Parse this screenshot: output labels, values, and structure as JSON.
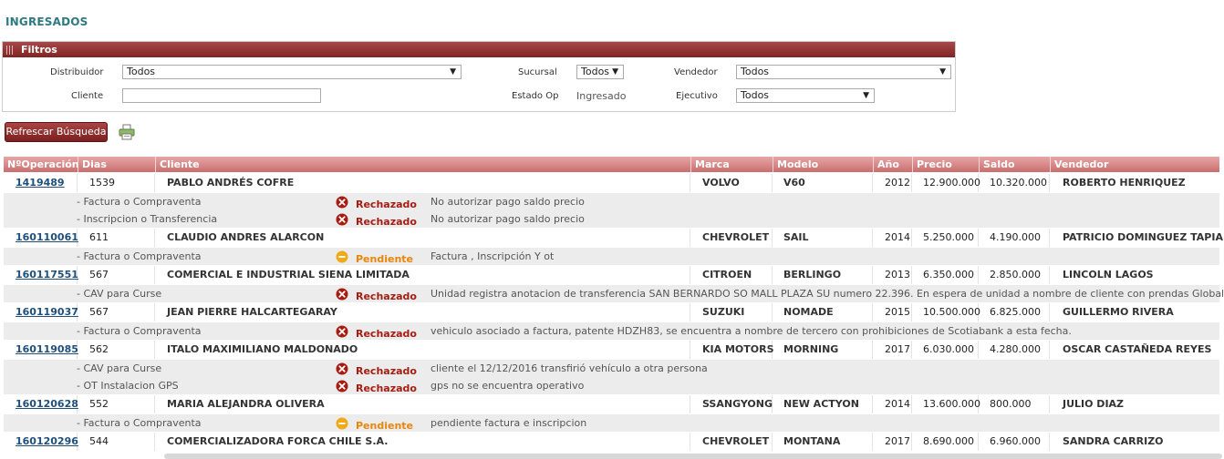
{
  "page": {
    "title": "INGRESADOS"
  },
  "filters": {
    "header": "Filtros",
    "distribuidor": {
      "label": "Distribuidor",
      "value": "Todos"
    },
    "sucursal": {
      "label": "Sucursal",
      "value": "Todos"
    },
    "vendedor": {
      "label": "Vendedor",
      "value": "Todos"
    },
    "cliente": {
      "label": "Cliente",
      "value": ""
    },
    "estado_op": {
      "label": "Estado Op",
      "value": "Ingresado"
    },
    "ejecutivo": {
      "label": "Ejecutivo",
      "value": "Todos"
    }
  },
  "toolbar": {
    "refresh_label": "Refrescar Búsqueda"
  },
  "table": {
    "columns": {
      "operacion": "NºOperación",
      "dias": "Dias Retenido",
      "cliente": "Cliente",
      "marca": "Marca",
      "modelo": "Modelo",
      "anio": "Año",
      "precio": "Precio",
      "saldo": "Saldo Precio",
      "vendedor": "Vendedor"
    },
    "rows": [
      {
        "op": "1419489",
        "dias": "1539",
        "cliente": "PABLO ANDRÉS COFRE",
        "marca": "VOLVO",
        "modelo": "V60",
        "anio": "2012",
        "precio": "12.900.000",
        "saldo": "10.320.000",
        "vendedor": "ROBERTO HENRIQUEZ",
        "details": [
          {
            "doc": "Factura o Compraventa",
            "status": "Rechazado",
            "comment": "No autorizar pago saldo precio"
          },
          {
            "doc": "Inscripcion o Transferencia",
            "status": "Rechazado",
            "comment": "No autorizar pago saldo precio"
          }
        ]
      },
      {
        "op": "160110061",
        "dias": "611",
        "cliente": "CLAUDIO ANDRES ALARCON",
        "marca": "CHEVROLET",
        "modelo": "SAIL",
        "anio": "2014",
        "precio": "5.250.000",
        "saldo": "4.190.000",
        "vendedor": "PATRICIO DOMINGUEZ TAPIA",
        "details": [
          {
            "doc": "Factura o Compraventa",
            "status": "Pendiente",
            "comment": "Factura , Inscripción Y ot"
          }
        ]
      },
      {
        "op": "160117551",
        "dias": "567",
        "cliente": "COMERCIAL E INDUSTRIAL SIENA LIMITADA",
        "marca": "CITROEN",
        "modelo": "BERLINGO",
        "anio": "2013",
        "precio": "6.350.000",
        "saldo": "2.850.000",
        "vendedor": "LINCOLN LAGOS",
        "details": [
          {
            "doc": "CAV para Curse",
            "status": "Rechazado",
            "comment": "Unidad registra anotacion de transferencia SAN BERNARDO SO MALL PLAZA SU numero 22.396. En espera de unidad a nombre de cliente con prendas Global efectivas."
          }
        ]
      },
      {
        "op": "160119037",
        "dias": "567",
        "cliente": "JEAN PIERRE HALCARTEGARAY",
        "marca": "SUZUKI",
        "modelo": "NOMADE",
        "anio": "2015",
        "precio": "10.500.000",
        "saldo": "6.825.000",
        "vendedor": "GUILLERMO RIVERA",
        "details": [
          {
            "doc": "Factura o Compraventa",
            "status": "Rechazado",
            "comment": "vehiculo asociado a factura, patente HDZH83, se encuentra a nombre de tercero con prohibiciones de Scotiabank a esta fecha."
          }
        ]
      },
      {
        "op": "160119085",
        "dias": "562",
        "cliente": "ITALO MAXIMILIANO MALDONADO",
        "marca": "KIA MOTORS",
        "modelo": "MORNING",
        "anio": "2017",
        "precio": "6.030.000",
        "saldo": "4.280.000",
        "vendedor": "OSCAR CASTAÑEDA REYES",
        "details": [
          {
            "doc": "CAV para Curse",
            "status": "Rechazado",
            "comment": "cliente el 12/12/2016 transfirió vehículo a otra persona"
          },
          {
            "doc": "OT Instalacion GPS",
            "status": "Rechazado",
            "comment": "gps no se encuentra operativo"
          }
        ]
      },
      {
        "op": "160120628",
        "dias": "552",
        "cliente": "MARIA ALEJANDRA OLIVERA",
        "marca": "SSANGYONG",
        "modelo": "NEW ACTYON",
        "anio": "2014",
        "precio": "13.600.000",
        "saldo": "800.000",
        "vendedor": "JULIO DIAZ",
        "details": [
          {
            "doc": "Factura o Compraventa",
            "status": "Pendiente",
            "comment": "pendiente factura e inscripcion"
          }
        ]
      },
      {
        "op": "160120296",
        "dias": "544",
        "cliente": "COMERCIALIZADORA FORCA CHILE S.A.",
        "marca": "CHEVROLET",
        "modelo": "MONTANA",
        "anio": "2017",
        "precio": "8.690.000",
        "saldo": "6.960.000",
        "vendedor": "SANDRA CARRIZO",
        "details": []
      }
    ]
  },
  "colors": {
    "header_red": "#8a2e2e",
    "title_teal": "#2f7a80",
    "rechazado": "#a51d12",
    "pendiente": "#e8860a"
  },
  "icons": {
    "print": "printer-icon",
    "rechazado": "x-circle-icon",
    "pendiente": "minus-circle-icon"
  }
}
